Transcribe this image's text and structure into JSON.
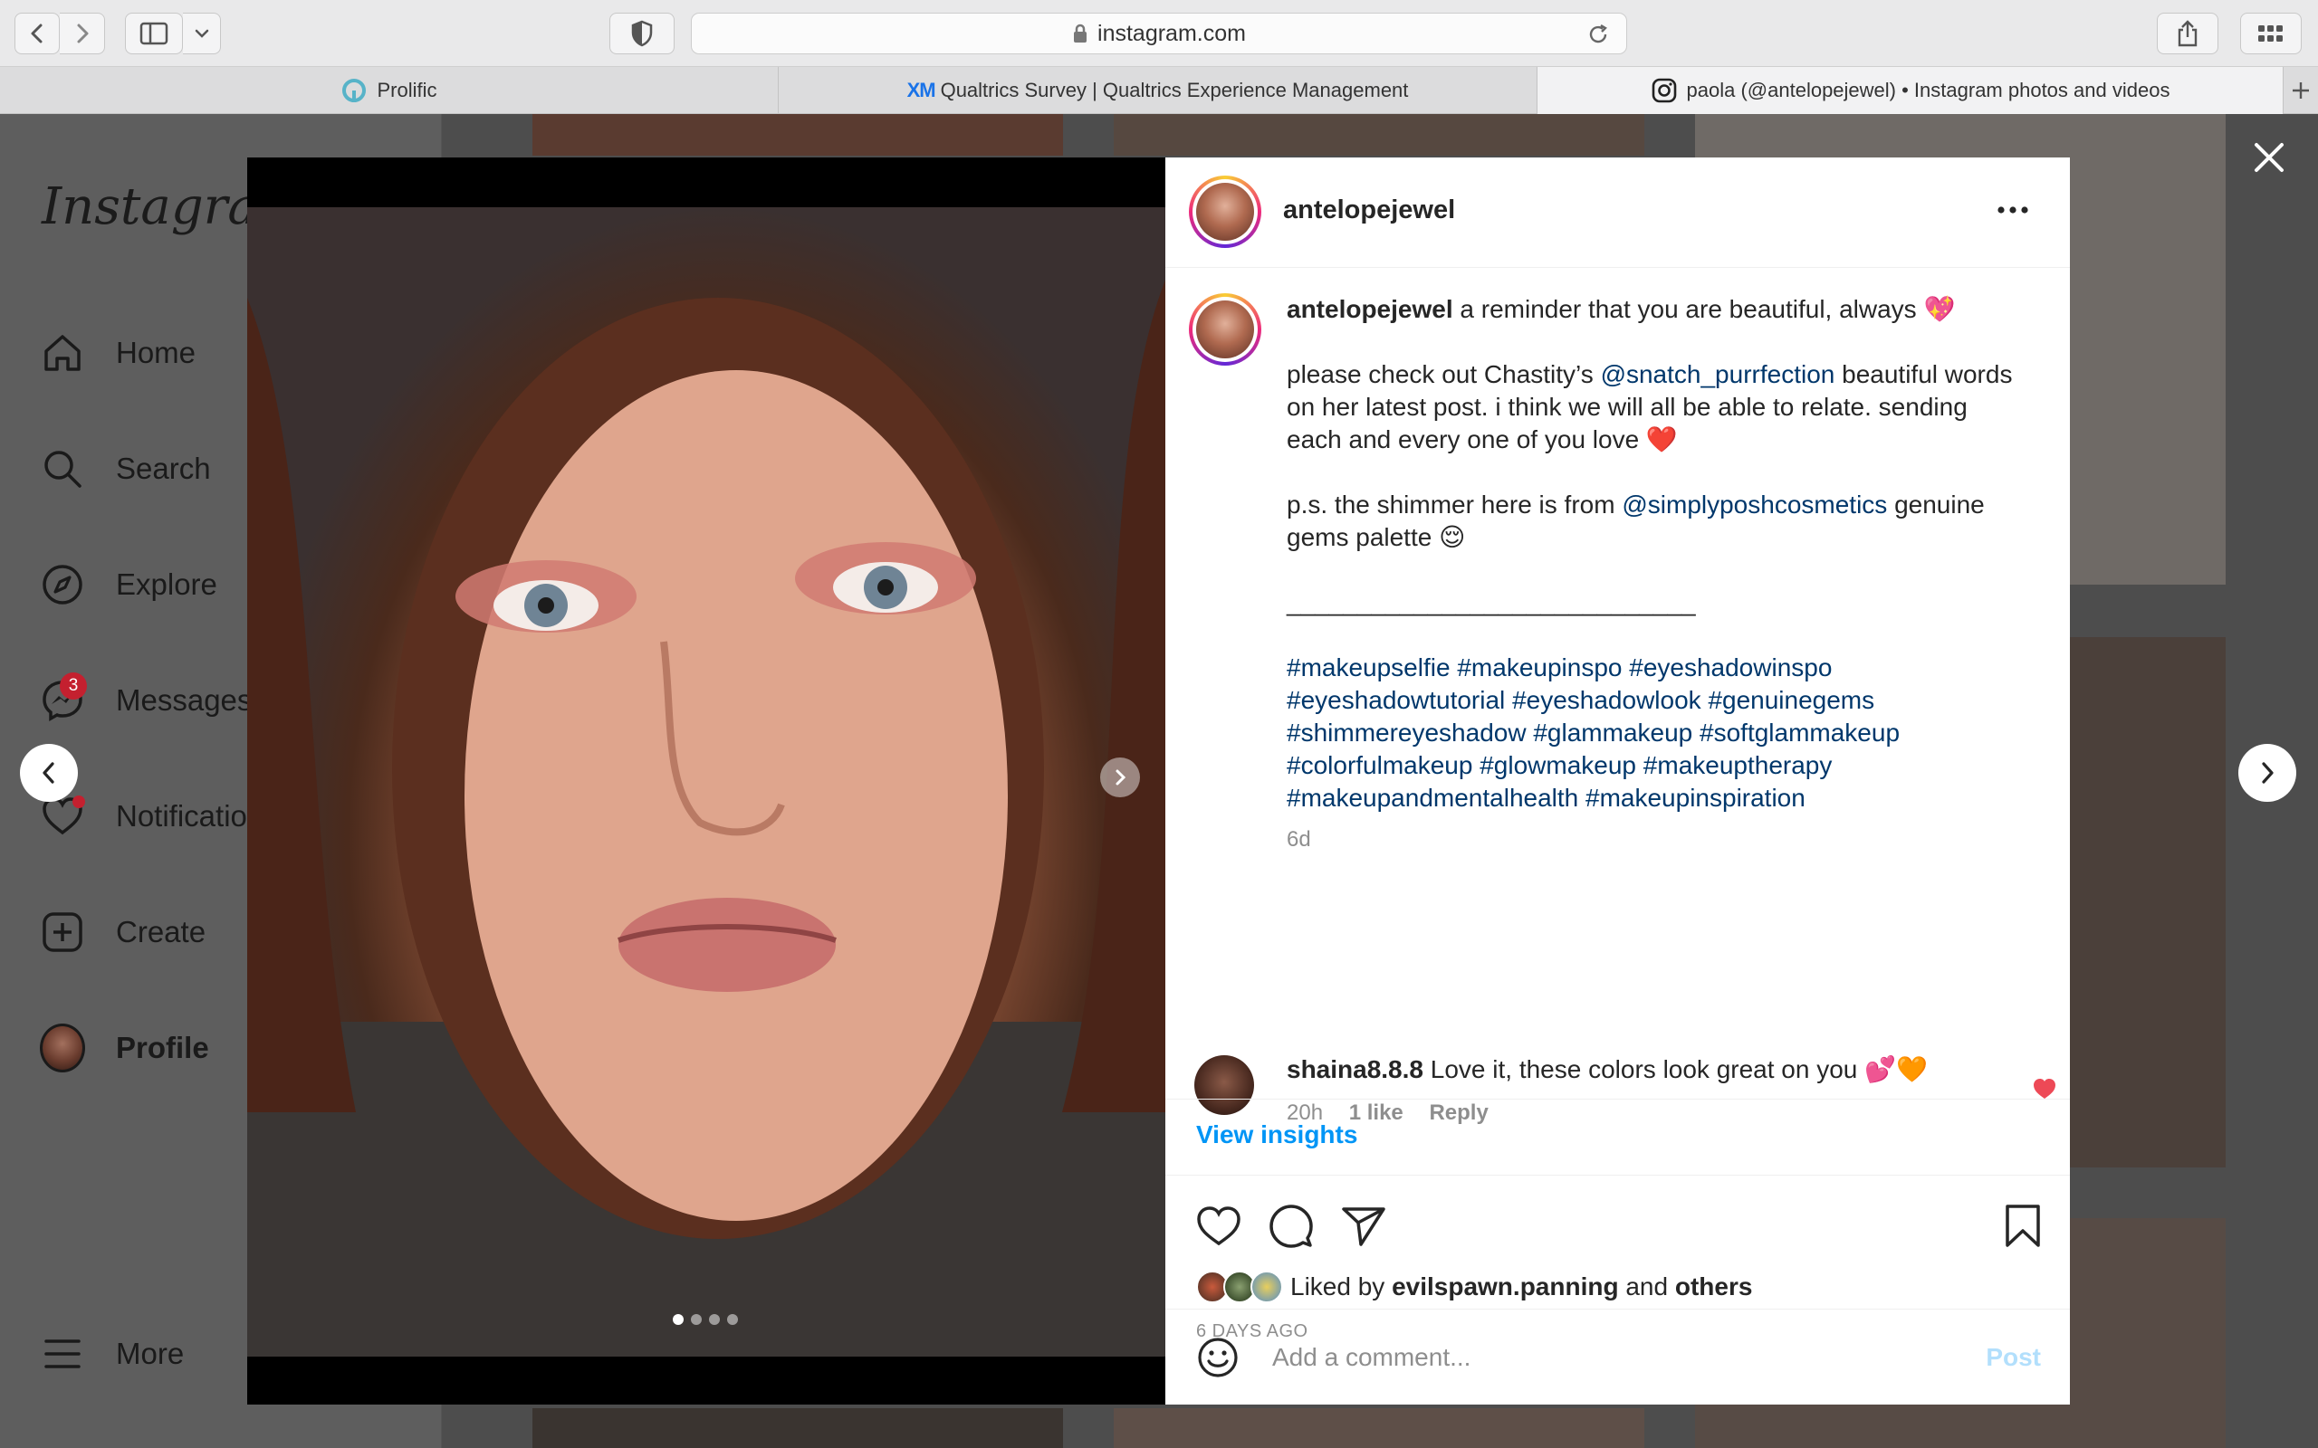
{
  "browser": {
    "url": "instagram.com",
    "tabs": [
      {
        "label": "Prolific",
        "icon": "prolific-icon",
        "active": false
      },
      {
        "label": "Qualtrics Survey | Qualtrics Experience Management",
        "icon": "qualtrics-xm-icon",
        "icon_text": "XM",
        "active": false
      },
      {
        "label": "paola (@antelopejewel) • Instagram photos and videos",
        "icon": "instagram-icon",
        "active": true
      }
    ]
  },
  "sidebar": {
    "logo": "Instagram",
    "items": [
      {
        "label": "Home",
        "icon": "home-icon"
      },
      {
        "label": "Search",
        "icon": "search-icon"
      },
      {
        "label": "Explore",
        "icon": "compass-icon"
      },
      {
        "label": "Messages",
        "icon": "messenger-icon",
        "badge": "3"
      },
      {
        "label": "Notifications",
        "icon": "heart-icon"
      },
      {
        "label": "Create",
        "icon": "plus-square-icon"
      },
      {
        "label": "Profile",
        "icon": "avatar"
      },
      {
        "label": "More",
        "icon": "menu-icon"
      }
    ]
  },
  "post": {
    "username": "antelopejewel",
    "caption": {
      "line1_text": " a reminder that you are beautiful, always 💖",
      "p2_pre": "please check out Chastity’s ",
      "p2_mention": "@snatch_purrfection",
      "p2_post": " beautiful words on her latest post. i think we will all be able to relate. sending each and every one of you love ❤️",
      "p3_pre": "p.s. the shimmer here is from ",
      "p3_mention": "@simplyposhcosmetics",
      "p3_post": " genuine gems palette 😌",
      "separator": "_____________________________",
      "hashtags": [
        "#makeupselfie",
        "#makeupinspo",
        "#eyeshadowinspo",
        "#eyeshadowtutorial",
        "#eyeshadowlook",
        "#genuinegems",
        "#shimmereyeshadow",
        "#glammakeup",
        "#softglammakeup",
        "#colorfulmakeup",
        "#glowmakeup",
        "#makeuptherapy",
        "#makeupandmentalhealth",
        "#makeupinspiration"
      ],
      "age": "6d"
    },
    "comments": [
      {
        "user": "shaina8.8.8",
        "text": " Love it, these colors look great on you 💕🧡",
        "time": "20h",
        "likes": "1 like",
        "reply": "Reply",
        "liked": true
      }
    ],
    "view_insights": "View insights",
    "liked_by": {
      "prefix": "Liked by ",
      "user": "evilspawn.panning",
      "mid": " and ",
      "others": "others"
    },
    "date": "6 DAYS AGO",
    "comment_placeholder": "Add a comment...",
    "post_button": "Post",
    "carousel": {
      "count": 4,
      "active": 0
    }
  },
  "colors": {
    "link": "#00376b",
    "accent": "#0095f6",
    "like_red": "#ed4956"
  }
}
